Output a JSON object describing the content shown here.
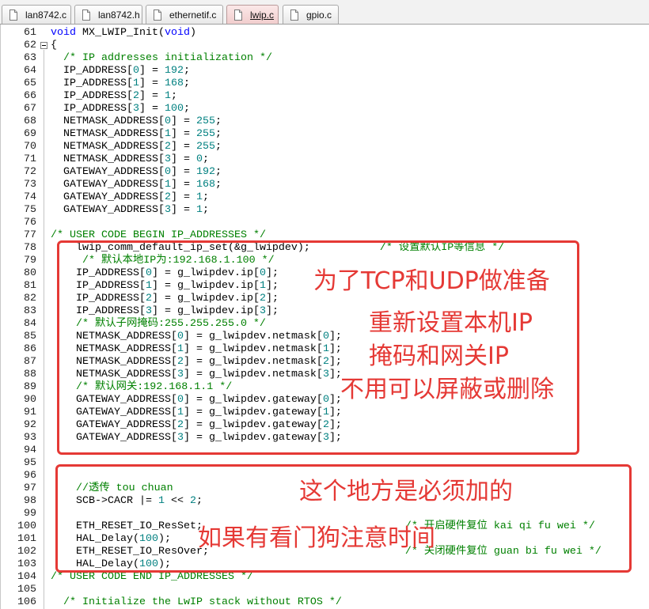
{
  "tabs": [
    {
      "label": "lan8742.c",
      "icon": "c-file-icon",
      "active": false
    },
    {
      "label": "lan8742.h",
      "icon": "h-file-icon",
      "active": false
    },
    {
      "label": "ethernetif.c",
      "icon": "c-file-icon",
      "active": false
    },
    {
      "label": "lwip.c",
      "icon": "c-file-icon",
      "active": true
    },
    {
      "label": "gpio.c",
      "icon": "c-file-icon",
      "active": false
    }
  ],
  "editor": {
    "lines": [
      {
        "n": 61,
        "code": "void MX_LWIP_Init(void)"
      },
      {
        "n": 62,
        "code": "{",
        "fold": true
      },
      {
        "n": 63,
        "code": "  /* IP addresses initialization */"
      },
      {
        "n": 64,
        "code": "  IP_ADDRESS[0] = 192;"
      },
      {
        "n": 65,
        "code": "  IP_ADDRESS[1] = 168;"
      },
      {
        "n": 66,
        "code": "  IP_ADDRESS[2] = 1;"
      },
      {
        "n": 67,
        "code": "  IP_ADDRESS[3] = 100;"
      },
      {
        "n": 68,
        "code": "  NETMASK_ADDRESS[0] = 255;"
      },
      {
        "n": 69,
        "code": "  NETMASK_ADDRESS[1] = 255;"
      },
      {
        "n": 70,
        "code": "  NETMASK_ADDRESS[2] = 255;"
      },
      {
        "n": 71,
        "code": "  NETMASK_ADDRESS[3] = 0;"
      },
      {
        "n": 72,
        "code": "  GATEWAY_ADDRESS[0] = 192;"
      },
      {
        "n": 73,
        "code": "  GATEWAY_ADDRESS[1] = 168;"
      },
      {
        "n": 74,
        "code": "  GATEWAY_ADDRESS[2] = 1;"
      },
      {
        "n": 75,
        "code": "  GATEWAY_ADDRESS[3] = 1;"
      },
      {
        "n": 76,
        "code": ""
      },
      {
        "n": 77,
        "code": "/* USER CODE BEGIN IP_ADDRESSES */"
      },
      {
        "n": 78,
        "code": "    lwip_comm_default_ip_set(&g_lwipdev);           /* 设置默认IP等信息 */"
      },
      {
        "n": 79,
        "code": "     /* 默认本地IP为:192.168.1.100 */"
      },
      {
        "n": 80,
        "code": "    IP_ADDRESS[0] = g_lwipdev.ip[0];"
      },
      {
        "n": 81,
        "code": "    IP_ADDRESS[1] = g_lwipdev.ip[1];"
      },
      {
        "n": 82,
        "code": "    IP_ADDRESS[2] = g_lwipdev.ip[2];"
      },
      {
        "n": 83,
        "code": "    IP_ADDRESS[3] = g_lwipdev.ip[3];"
      },
      {
        "n": 84,
        "code": "    /* 默认子网掩码:255.255.255.0 */"
      },
      {
        "n": 85,
        "code": "    NETMASK_ADDRESS[0] = g_lwipdev.netmask[0];"
      },
      {
        "n": 86,
        "code": "    NETMASK_ADDRESS[1] = g_lwipdev.netmask[1];"
      },
      {
        "n": 87,
        "code": "    NETMASK_ADDRESS[2] = g_lwipdev.netmask[2];"
      },
      {
        "n": 88,
        "code": "    NETMASK_ADDRESS[3] = g_lwipdev.netmask[3];"
      },
      {
        "n": 89,
        "code": "    /* 默认网关:192.168.1.1 */"
      },
      {
        "n": 90,
        "code": "    GATEWAY_ADDRESS[0] = g_lwipdev.gateway[0];"
      },
      {
        "n": 91,
        "code": "    GATEWAY_ADDRESS[1] = g_lwipdev.gateway[1];"
      },
      {
        "n": 92,
        "code": "    GATEWAY_ADDRESS[2] = g_lwipdev.gateway[2];"
      },
      {
        "n": 93,
        "code": "    GATEWAY_ADDRESS[3] = g_lwipdev.gateway[3];"
      },
      {
        "n": 94,
        "code": ""
      },
      {
        "n": 95,
        "code": ""
      },
      {
        "n": 96,
        "code": ""
      },
      {
        "n": 97,
        "code": "    //透传 tou chuan"
      },
      {
        "n": 98,
        "code": "    SCB->CACR |= 1 << 2;"
      },
      {
        "n": 99,
        "code": ""
      },
      {
        "n": 100,
        "code": "    ETH_RESET_IO_ResSet;                                /* 开启硬件复位 kai qi fu wei */"
      },
      {
        "n": 101,
        "code": "    HAL_Delay(100);"
      },
      {
        "n": 102,
        "code": "    ETH_RESET_IO_ResOver;                               /* 关闭硬件复位 guan bi fu wei */"
      },
      {
        "n": 103,
        "code": "    HAL_Delay(100);"
      },
      {
        "n": 104,
        "code": "/* USER CODE END IP_ADDRESSES */"
      },
      {
        "n": 105,
        "code": ""
      },
      {
        "n": 106,
        "code": "  /* Initialize the LwIP stack without RTOS */"
      }
    ]
  },
  "annotations": {
    "box1": [
      "为了TCP和UDP做准备",
      "重新设置本机IP",
      "掩码和网关IP",
      "不用可以屏蔽或删除"
    ],
    "box2": [
      "这个地方是必须加的",
      "如果有看门狗注意时间"
    ]
  },
  "colors": {
    "annotation_red": "#e53935",
    "comment": "#008000",
    "keyword": "#0000ff",
    "number": "#008080"
  }
}
